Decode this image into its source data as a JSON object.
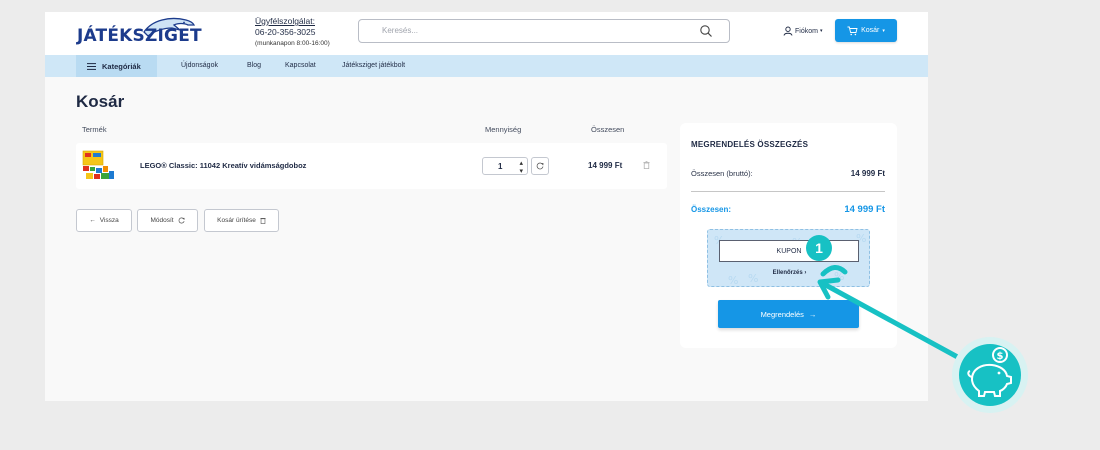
{
  "header": {
    "logo_text": "JÁTÉKSZIGET",
    "service_title": "Ügyfélszolgálat:",
    "service_phone": "06-20-356-3025",
    "service_hours": "(munkanapon 8:00-16:00)",
    "search_placeholder": "Keresés...",
    "account_label": "Fiókom",
    "cart_label": "Kosár"
  },
  "nav": {
    "categories_label": "Kategóriák",
    "links": [
      "Újdonságok",
      "Blog",
      "Kapcsolat",
      "Játéksziget játékbolt"
    ]
  },
  "cart": {
    "title": "Kosár",
    "columns": {
      "product": "Termék",
      "quantity": "Mennyiség",
      "total": "Összesen"
    },
    "items": [
      {
        "name": "LEGO® Classic: 11042 Kreatív vidámságdoboz",
        "quantity": "1",
        "total": "14 999 Ft"
      }
    ],
    "buttons": {
      "back": "Vissza",
      "modify": "Módosít",
      "clear": "Kosár ürítése"
    }
  },
  "summary": {
    "title": "MEGRENDELÉS ÖSSZEGZÉS",
    "gross_label": "Összesen (bruttó):",
    "gross_value": "14 999 Ft",
    "total_label": "Összesen:",
    "total_value": "14 999 Ft",
    "coupon_value": "KUPON",
    "coupon_check_label": "Ellenőrzés",
    "order_button": "Megrendelés"
  },
  "annotation": {
    "step_number": "1"
  },
  "colors": {
    "accent": "#1596e6",
    "teal": "#17c1c4",
    "nav_bg": "#cfe7f7",
    "brand": "#1c3b8c"
  }
}
